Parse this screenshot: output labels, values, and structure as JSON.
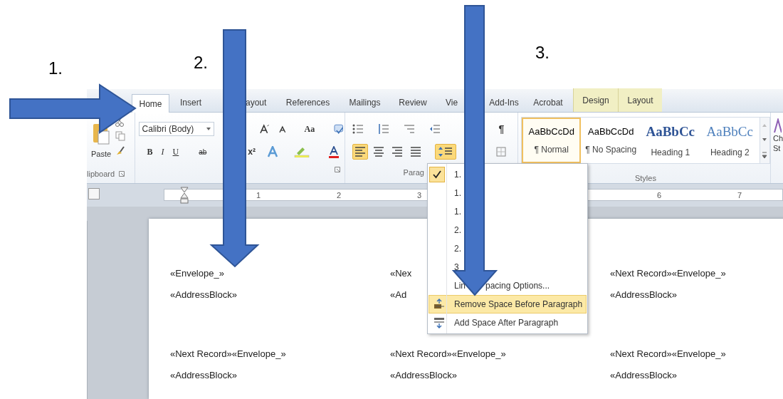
{
  "steps": [
    "1.",
    "2.",
    "3."
  ],
  "tabs": [
    {
      "label": "Home",
      "selected": true,
      "kind": "main"
    },
    {
      "label": "Insert",
      "selected": false,
      "kind": "main"
    },
    {
      "label": "ayout",
      "selected": false,
      "kind": "main"
    },
    {
      "label": "References",
      "selected": false,
      "kind": "main"
    },
    {
      "label": "Mailings",
      "selected": false,
      "kind": "main"
    },
    {
      "label": "Review",
      "selected": false,
      "kind": "main"
    },
    {
      "label": "Vie",
      "selected": false,
      "kind": "main"
    },
    {
      "label": "Add-Ins",
      "selected": false,
      "kind": "main"
    },
    {
      "label": "Acrobat",
      "selected": false,
      "kind": "main"
    },
    {
      "label": "Design",
      "selected": false,
      "kind": "contextual"
    },
    {
      "label": "Layout",
      "selected": false,
      "kind": "contextual"
    }
  ],
  "clipboard": {
    "paste_label": "Paste",
    "group_label": "lipboard"
  },
  "font": {
    "font_name": "Calibri (Body)",
    "change_case": "Aa",
    "bold": "B",
    "italic": "I",
    "underline": "U",
    "strike": "ab",
    "superscript": "x²"
  },
  "paragraph": {
    "group_label": "Parag",
    "pilcrow": "¶",
    "align_buttons": [
      {
        "kind": "left",
        "selected": true
      },
      {
        "kind": "center",
        "selected": false
      },
      {
        "kind": "right",
        "selected": false
      },
      {
        "kind": "justify",
        "selected": false
      }
    ],
    "line_spacing_button": {
      "selected": true
    }
  },
  "styles": {
    "group_label": "Styles",
    "side_label": [
      "Ch",
      "St"
    ],
    "items": [
      {
        "preview": "AaBbCcDd",
        "name": "¶ Normal",
        "kind": "body",
        "selected": true
      },
      {
        "preview": "AaBbCcDd",
        "name": "¶ No Spacing",
        "kind": "body",
        "selected": false
      },
      {
        "preview": "AaBbCc",
        "name": "Heading 1",
        "kind": "heading1",
        "selected": false
      },
      {
        "preview": "AaBbCc",
        "name": "Heading 2",
        "kind": "heading2",
        "selected": false
      }
    ]
  },
  "ruler_numbers": [
    "1",
    "2",
    "3",
    "6",
    "7"
  ],
  "menu": {
    "items": [
      {
        "label": "1.",
        "checked": true
      },
      {
        "label": "1.",
        "checked": false
      },
      {
        "label": "1.",
        "checked": false
      },
      {
        "label": "2.",
        "checked": false
      },
      {
        "label": "2.",
        "checked": false
      },
      {
        "label": "3",
        "checked": false
      }
    ],
    "options_parts": [
      "Lin",
      "pacing Options..."
    ],
    "actions": [
      {
        "label": "Remove Space Before Paragraph",
        "kind": "remove",
        "selected": true
      },
      {
        "label": "Add Space After Paragraph",
        "kind": "add",
        "selected": false
      }
    ]
  },
  "document": {
    "rows": [
      [
        [
          "«Envelope_»",
          "«AddressBlock»"
        ],
        [
          "«Nex",
          "«Ad"
        ],
        [
          "«Next Record»«Envelope_»",
          "«AddressBlock»"
        ]
      ],
      [
        [
          "«Next Record»«Envelope_»",
          "«AddressBlock»"
        ],
        [
          "«Next Record»«Envelope_»",
          "«AddressBlock»"
        ],
        [
          "«Next Record»«Envelope_»",
          "«AddressBlock»"
        ]
      ]
    ]
  }
}
